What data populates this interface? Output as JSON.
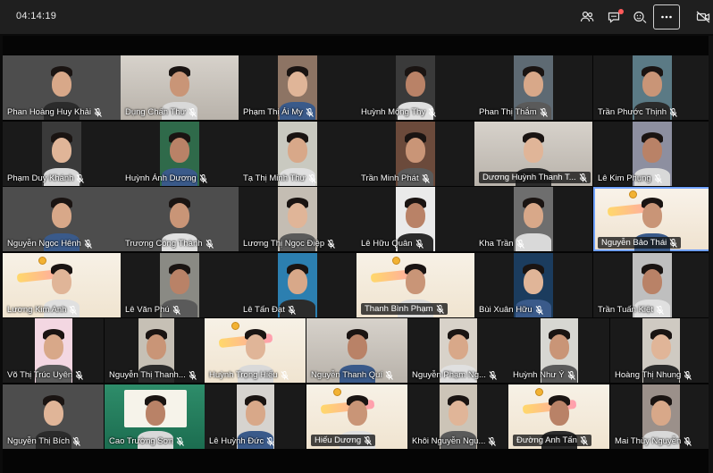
{
  "meeting": {
    "elapsed": "04:14:19"
  },
  "toolbar": {
    "participants_icon": "people-icon",
    "chat_icon": "chat-icon",
    "reactions_icon": "reaction-icon",
    "more_icon": "more-options-icon",
    "camera_icon": "camera-off-icon"
  },
  "colors": {
    "selected_border": "#6fa0ff",
    "banner_red": "#e73a50",
    "notification": "#ff5a5a"
  },
  "participants": [
    [
      "Phan Hoàng Huy Khải",
      "Dụng Chấn Thư",
      "Phạm Thị Ái My",
      "Huỳnh Mộng Thy",
      "Phan Thị Thắm",
      "Trần Phước Thịnh"
    ],
    [
      "Phạm Duy Khánh",
      "Huỳnh Ánh Dương",
      "Tạ Thị Minh Thư",
      "Trần Minh Phát",
      "Dương Huỳnh Thanh T...",
      "Lê Kim Phụng"
    ],
    [
      "Nguyễn Ngọc Hênh",
      "Trương Công Thành",
      "Lương Thị Ngọc Điệp",
      "Lê Hữu Quân",
      "Kha Trần",
      "Nguyễn Bảo Thái"
    ],
    [
      "Lương Kim Anh",
      "Lê Văn Phú",
      "Lê Tấn Đạt",
      "Thanh Bình Phạm",
      "Bùi Xuân Hữu",
      "Trần Tuấn Kiệt"
    ],
    [
      "Võ Thị Trúc Uyên",
      "Nguyễn Thị Thanh...",
      "Huỳnh Trọng Hiếu",
      "Nguyễn Thanh Quí",
      "Nguyễn Phạm Ng...",
      "Huỳnh Như Ý",
      "Hoàng Thị Nhung"
    ],
    [
      "Nguyễn Thị Bích",
      "Cao Trường Sơn",
      "Lê Huỳnh Đức",
      "Hiếu Dương",
      "Khôi Nguyễn Ngu...",
      "Đường Anh Tấn",
      "Mai Thùy Nguyễn"
    ]
  ]
}
